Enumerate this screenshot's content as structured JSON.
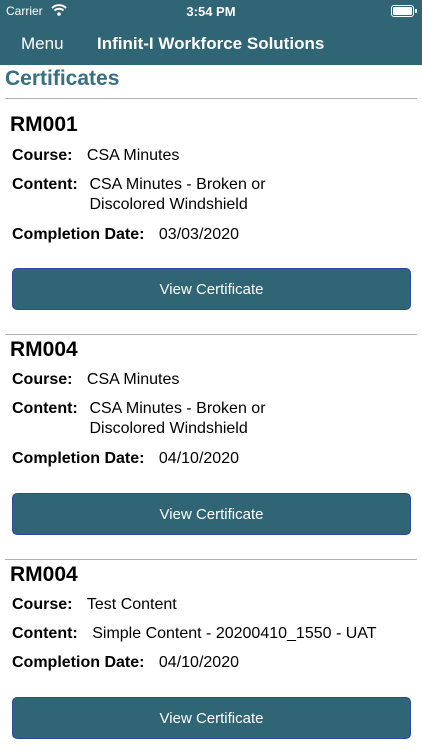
{
  "status_bar": {
    "carrier": "Carrier",
    "time": "3:54 PM"
  },
  "nav": {
    "menu_label": "Menu",
    "title": "Infinit-I Workforce Solutions"
  },
  "page": {
    "title": "Certificates"
  },
  "labels": {
    "course": "Course:",
    "content": "Content:",
    "completion": "Completion Date:",
    "button": "View Certificate"
  },
  "certificates": [
    {
      "id": "RM001",
      "course": "CSA Minutes",
      "content_line1": "CSA Minutes - Broken or",
      "content_line2": "Discolored Windshield",
      "completion_date": "03/03/2020"
    },
    {
      "id": "RM004",
      "course": "CSA Minutes",
      "content_line1": "CSA Minutes - Broken or",
      "content_line2": "Discolored Windshield",
      "completion_date": "04/10/2020"
    },
    {
      "id": "RM004",
      "course": "Test Content",
      "content_line1": "Simple Content - 20200410_1550 - UAT",
      "completion_date": "04/10/2020"
    }
  ]
}
